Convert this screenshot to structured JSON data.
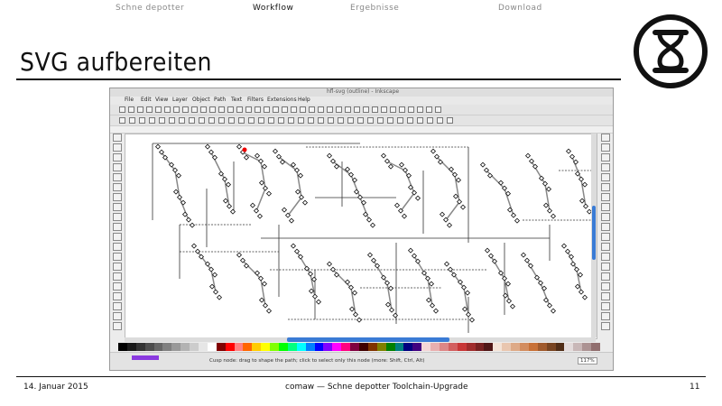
{
  "nav": {
    "items": [
      {
        "label": "Schne depotter",
        "active": false
      },
      {
        "label": "Workflow",
        "active": true
      },
      {
        "label": "Ergebnisse",
        "active": false
      },
      {
        "label": "Download",
        "active": false
      }
    ]
  },
  "slide": {
    "title": "SVG aufbereiten"
  },
  "screenshot": {
    "window_title": "hfl-svg (outline) - Inkscape",
    "menu": [
      "File",
      "Edit",
      "View",
      "Layer",
      "Object",
      "Path",
      "Text",
      "Filters",
      "Extensions",
      "Help"
    ],
    "status_text": "Cusp node: drag to shape the path; click to select only this node (more: Shift, Ctrl, Alt)",
    "zoom": "117%",
    "fill_color": "#8a3adf"
  },
  "footer": {
    "date": "14. Januar 2015",
    "center": "comaw   — Schne depotter Toolchain-Upgrade",
    "page": "11"
  },
  "colors": {
    "accent": "#111111",
    "scroll": "#3a7bd5"
  }
}
